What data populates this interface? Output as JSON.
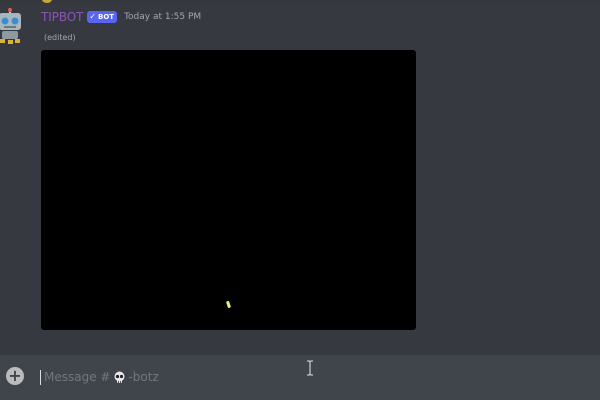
{
  "message": {
    "author": "TIPBOT",
    "bot_tag": "BOT",
    "bot_check": "✓",
    "timestamp": "Today at 1:55 PM",
    "edited_label": "(edited)"
  },
  "composer": {
    "placeholder_prefix": "Message #",
    "placeholder_suffix": "-botz",
    "add_icon": "+"
  },
  "colors": {
    "background": "#36393f",
    "composer_bg": "#40444b",
    "username": "#8a55b7",
    "bot_tag_bg": "#5865f2",
    "muted_text": "#a3a6aa",
    "media_bg": "#000000"
  },
  "icons": {
    "avatar": "robot-avatar-icon",
    "add": "plus-circle-icon",
    "channel": "skull-emoji-icon",
    "cursor": "text-cursor-icon"
  }
}
